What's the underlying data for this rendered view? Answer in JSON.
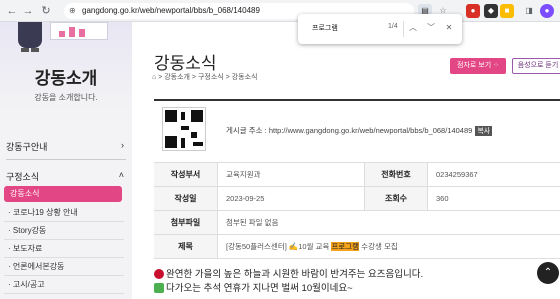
{
  "browser": {
    "url": "gangdong.go.kr/web/newportal/bbs/b_068/140489",
    "find_query": "프로그램",
    "find_count": "1/4"
  },
  "sidebar": {
    "title": "강동소개",
    "subtitle": "강동을 소개합니다.",
    "menu1": "강동구안내",
    "menu2": "구정소식",
    "active_item": "강동소식",
    "items": [
      "코로나19 상황 안내",
      "Story강동",
      "보도자료",
      "언론에서본강동",
      "고시/공고"
    ]
  },
  "page": {
    "title": "강동소식",
    "breadcrumb": [
      "강동소개",
      "구정소식",
      "강동소식"
    ],
    "btn_enlarge": "점자로 보기",
    "btn_audio": "음성으로 듣기"
  },
  "article": {
    "address_label": "게시글 주소 : http://www.gangdong.go.kr/web/newportal/bbs/b_068/140489",
    "copy": "복사",
    "author_label": "작성부서",
    "author": "교육지원과",
    "phone_label": "전화번호",
    "phone": "0234259367",
    "date_label": "작성일",
    "date": "2023-09-25",
    "views_label": "조회수",
    "views": "360",
    "attach_label": "첨부파일",
    "attach": "첨부된 파일 없음",
    "subject_label": "제목",
    "subject_pre": "[강동50플러스센터] ",
    "subject_mid": "10월 교육",
    "subject_hl": "프로그램",
    "subject_post": " 수강생 모집",
    "line1": "완연한 가을의 높은 하늘과 시원한 바람이 반겨주는 요즈음입니다.",
    "line2": "다가오는 추석 연휴가 지나면 벌써 10월이네요~"
  }
}
